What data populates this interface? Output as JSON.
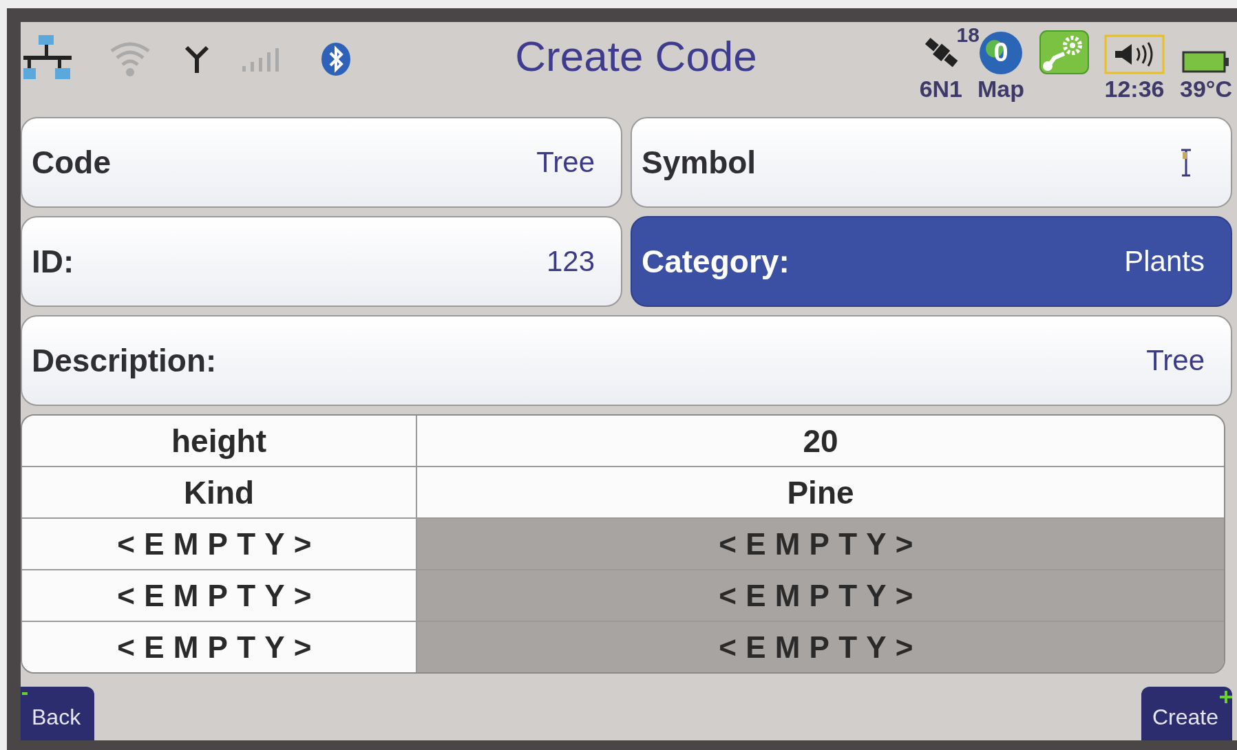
{
  "status_bar": {
    "title": "Create Code",
    "satellites": {
      "count": "18",
      "label": "6N1"
    },
    "map": {
      "badge": "0",
      "label": "Map"
    },
    "time": "12:36",
    "temperature": "39°C"
  },
  "fields": [
    {
      "label": "Code",
      "value": "Tree",
      "kind": "text",
      "selected": false
    },
    {
      "label": "Symbol",
      "kind": "symbol",
      "selected": false
    },
    {
      "label": "ID:",
      "value": "123",
      "kind": "text",
      "selected": false
    },
    {
      "label": "Category:",
      "value": "Plants",
      "kind": "text",
      "selected": true
    },
    {
      "label": "Description:",
      "value": "Tree",
      "kind": "text",
      "selected": false,
      "wide": true
    }
  ],
  "attributes": [
    {
      "name": "height",
      "value": "20",
      "disabled": false
    },
    {
      "name": "Kind",
      "value": "Pine",
      "disabled": false
    },
    {
      "name": "<EMPTY>",
      "value": "<EMPTY>",
      "disabled": true
    },
    {
      "name": "<EMPTY>",
      "value": "<EMPTY>",
      "disabled": true
    },
    {
      "name": "<EMPTY>",
      "value": "<EMPTY>",
      "disabled": true
    }
  ],
  "buttons": [
    {
      "label": "Back",
      "kind": "minus"
    },
    {
      "label": "Create",
      "kind": "plus"
    }
  ]
}
